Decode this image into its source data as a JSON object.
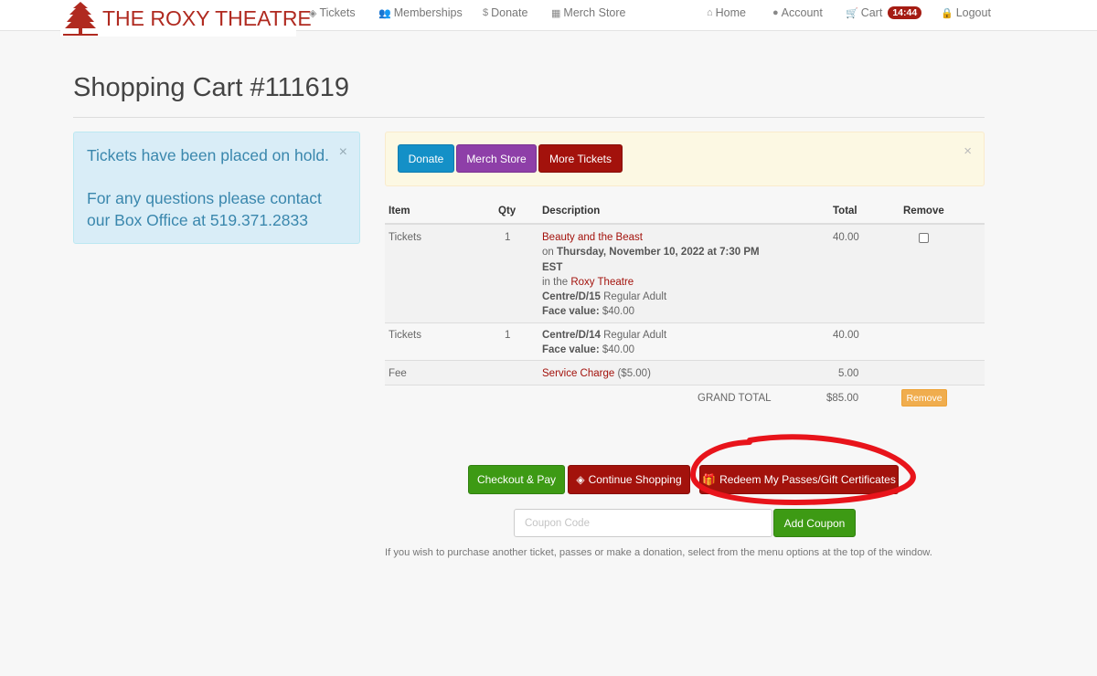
{
  "brand": {
    "name": "THE ROXY THEATRE",
    "color": "#b02a20"
  },
  "nav": {
    "left": [
      {
        "icon": "ticket-icon",
        "glyph": "◈",
        "label": "Tickets"
      },
      {
        "icon": "users-icon",
        "glyph": "👥",
        "label": "Memberships"
      },
      {
        "icon": "dollar-icon",
        "glyph": "$",
        "label": "Donate"
      },
      {
        "icon": "store-icon",
        "glyph": "▦",
        "label": "Merch Store"
      }
    ],
    "right": [
      {
        "icon": "home-icon",
        "glyph": "⌂",
        "label": "Home"
      },
      {
        "icon": "user-icon",
        "glyph": "●",
        "label": "Account"
      },
      {
        "icon": "cart-icon",
        "glyph": "🛒",
        "label": "Cart",
        "badge": "14:44"
      },
      {
        "icon": "lock-icon",
        "glyph": "🔒",
        "label": "Logout"
      }
    ]
  },
  "page": {
    "title": "Shopping Cart #111619"
  },
  "info_alert": {
    "line1": "Tickets have been placed on hold.",
    "line2": "For any questions please contact our Box Office at 519.371.2833",
    "close": "×"
  },
  "action_bar": {
    "donate": "Donate",
    "merch": "Merch Store",
    "more_tickets": "More Tickets",
    "close": "×"
  },
  "table": {
    "headers": {
      "item": "Item",
      "qty": "Qty",
      "description": "Description",
      "total": "Total",
      "remove": "Remove"
    },
    "rows": [
      {
        "item": "Tickets",
        "qty": "1",
        "event": "Beauty and the Beast",
        "on_prefix": "on",
        "datetime": "Thursday, November 10, 2022 at 7:30 PM EST",
        "in_prefix": "in the",
        "venue": "Roxy Theatre",
        "seat": "Centre/D/15",
        "seat_type": "Regular Adult",
        "face_label": "Face value:",
        "face_value": "$40.00",
        "total": "40.00",
        "remove_checked": false
      },
      {
        "item": "Tickets",
        "qty": "1",
        "seat": "Centre/D/14",
        "seat_type": "Regular Adult",
        "face_label": "Face value:",
        "face_value": "$40.00",
        "total": "40.00"
      },
      {
        "item": "Fee",
        "description_link": "Service Charge",
        "description_extra": "($5.00)",
        "total": "5.00"
      }
    ],
    "grand_total_label": "GRAND TOTAL",
    "grand_total": "$85.00",
    "remove_button": "Remove"
  },
  "actions": {
    "checkout": "Checkout & Pay",
    "continue": "Continue Shopping",
    "redeem": "Redeem My Passes/Gift Certificates"
  },
  "coupon": {
    "placeholder": "Coupon Code",
    "value": "",
    "button": "Add Coupon"
  },
  "help_text": "If you wish to purchase another ticket, passes or make a donation, select from the menu options at the top of the window.",
  "colors": {
    "accent_red": "#a3120c",
    "green": "#3d9a14",
    "annotation": "#e8141b"
  }
}
